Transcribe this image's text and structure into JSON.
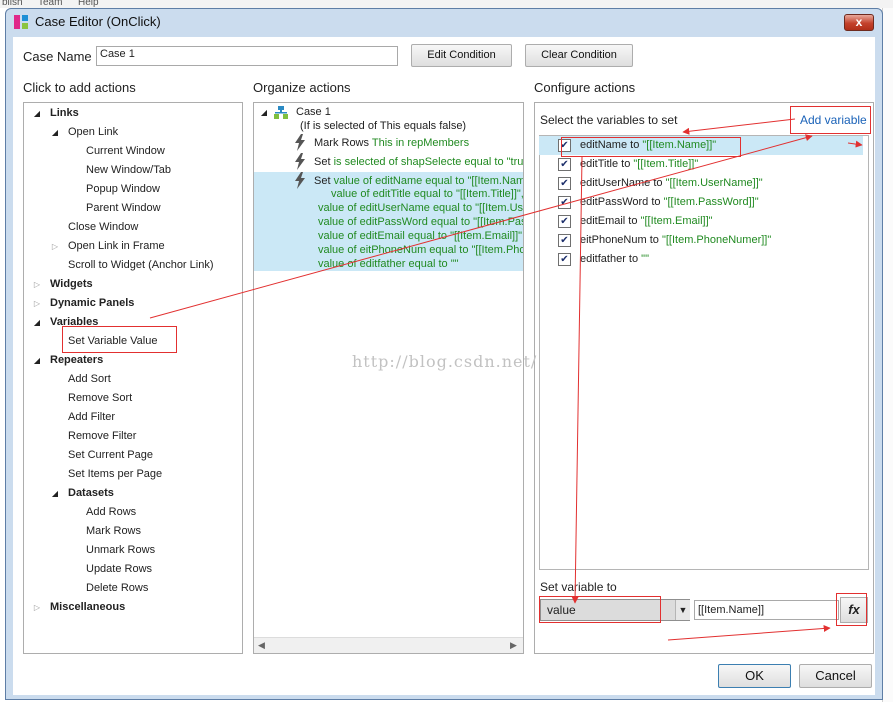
{
  "background_menu": [
    "blish",
    "Team",
    "Help"
  ],
  "window": {
    "title": "Case Editor (OnClick)",
    "close_label": "x"
  },
  "case_name": {
    "label": "Case Name",
    "value": "Case 1"
  },
  "buttons": {
    "edit_condition": "Edit Condition",
    "clear_condition": "Clear Condition",
    "ok": "OK",
    "cancel": "Cancel",
    "fx": "fx"
  },
  "sections": {
    "click_to_add": "Click to add actions",
    "organize": "Organize actions",
    "configure": "Configure actions"
  },
  "actions_tree": [
    {
      "label": "Links",
      "level": 0,
      "bold": true,
      "expander": "open"
    },
    {
      "label": "Open Link",
      "level": 1,
      "bold": false,
      "expander": "open"
    },
    {
      "label": "Current Window",
      "level": 2,
      "bold": false,
      "expander": "none"
    },
    {
      "label": "New Window/Tab",
      "level": 2,
      "bold": false,
      "expander": "none"
    },
    {
      "label": "Popup Window",
      "level": 2,
      "bold": false,
      "expander": "none"
    },
    {
      "label": "Parent Window",
      "level": 2,
      "bold": false,
      "expander": "none"
    },
    {
      "label": "Close Window",
      "level": 1,
      "bold": false,
      "expander": "none"
    },
    {
      "label": "Open Link in Frame",
      "level": 1,
      "bold": false,
      "expander": "closed"
    },
    {
      "label": "Scroll to Widget (Anchor Link)",
      "level": 1,
      "bold": false,
      "expander": "none"
    },
    {
      "label": "Widgets",
      "level": 0,
      "bold": true,
      "expander": "closed"
    },
    {
      "label": "Dynamic Panels",
      "level": 0,
      "bold": true,
      "expander": "closed"
    },
    {
      "label": "Variables",
      "level": 0,
      "bold": true,
      "expander": "open"
    },
    {
      "label": "Set Variable Value",
      "level": 1,
      "bold": false,
      "expander": "none"
    },
    {
      "label": "Repeaters",
      "level": 0,
      "bold": true,
      "expander": "open"
    },
    {
      "label": "Add Sort",
      "level": 1,
      "bold": false,
      "expander": "none"
    },
    {
      "label": "Remove Sort",
      "level": 1,
      "bold": false,
      "expander": "none"
    },
    {
      "label": "Add Filter",
      "level": 1,
      "bold": false,
      "expander": "none"
    },
    {
      "label": "Remove Filter",
      "level": 1,
      "bold": false,
      "expander": "none"
    },
    {
      "label": "Set Current Page",
      "level": 1,
      "bold": false,
      "expander": "none"
    },
    {
      "label": "Set Items per Page",
      "level": 1,
      "bold": false,
      "expander": "none"
    },
    {
      "label": "Datasets",
      "level": 1,
      "bold": true,
      "expander": "open"
    },
    {
      "label": "Add Rows",
      "level": 2,
      "bold": false,
      "expander": "none"
    },
    {
      "label": "Mark Rows",
      "level": 2,
      "bold": false,
      "expander": "none"
    },
    {
      "label": "Unmark Rows",
      "level": 2,
      "bold": false,
      "expander": "none"
    },
    {
      "label": "Update Rows",
      "level": 2,
      "bold": false,
      "expander": "none"
    },
    {
      "label": "Delete Rows",
      "level": 2,
      "bold": false,
      "expander": "none"
    },
    {
      "label": "Miscellaneous",
      "level": 0,
      "bold": true,
      "expander": "closed"
    }
  ],
  "organize": {
    "case_label": "Case 1",
    "condition": "(If is selected of This equals false)",
    "actions": [
      {
        "verb": "Mark Rows",
        "detail": "This in repMembers"
      },
      {
        "verb": "Set",
        "detail": "is selected of shapSelecte equal to \"true\""
      },
      {
        "verb": "Set",
        "detail": "value of editName equal to \"[[Item.Name]]\""
      }
    ],
    "set_continuation": [
      "value of editTitle equal to \"[[Item.Title]]\", and",
      "value of editUserName equal to \"[[Item.UserName]]\"",
      "value of editPassWord equal to \"[[Item.PassWord]]\"",
      "value of editEmail equal to \"[[Item.Email]]\", and",
      "value of eitPhoneNum equal to \"[[Item.PhoneNumer]]\"",
      "value of editfather equal to \"\""
    ]
  },
  "configure": {
    "select_label": "Select the variables to set",
    "add_variable": "Add variable",
    "variables": [
      {
        "name": "editName",
        "value": "\"[[Item.Name]]\"",
        "checked": true
      },
      {
        "name": "editTitle",
        "value": "\"[[Item.Title]]\"",
        "checked": true
      },
      {
        "name": "editUserName",
        "value": "\"[[Item.UserName]]\"",
        "checked": true
      },
      {
        "name": "editPassWord",
        "value": "\"[[Item.PassWord]]\"",
        "checked": true
      },
      {
        "name": "editEmail",
        "value": "\"[[Item.Email]]\"",
        "checked": true
      },
      {
        "name": "eitPhoneNum",
        "value": "\"[[Item.PhoneNumer]]\"",
        "checked": true
      },
      {
        "name": "editfather",
        "value": "\"\"",
        "checked": true
      }
    ],
    "set_to_label": "Set variable to",
    "set_to_type": "value",
    "set_to_value": "[[Item.Name]]"
  },
  "watermark": "http://blog.csdn.net/",
  "colors": {
    "selection": "#cbe8f6",
    "annotation_red": "#e23030",
    "green_text": "#218a21",
    "link_blue": "#1a62b8"
  }
}
